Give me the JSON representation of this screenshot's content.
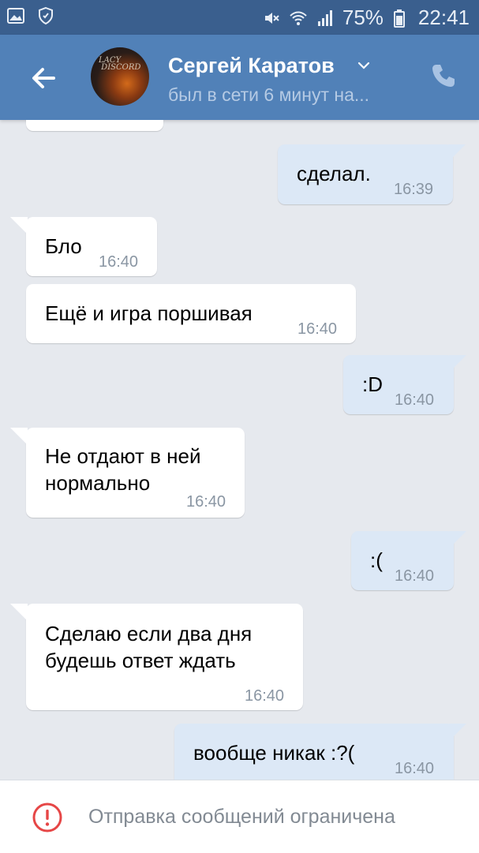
{
  "status_bar": {
    "battery": "75%",
    "time": "22:41"
  },
  "header": {
    "avatar_text": "LACY\nDISCORD",
    "name": "Сергей Каратов",
    "status": "был в сети 6 минут на..."
  },
  "messages": [
    {
      "dir": "out",
      "text": "сделал.",
      "time": "16:39"
    },
    {
      "dir": "in",
      "text": "Бло",
      "time": "16:40"
    },
    {
      "dir": "in",
      "text": "Ещё и игра поршивая",
      "time": "16:40"
    },
    {
      "dir": "out",
      "text": ":D",
      "time": "16:40"
    },
    {
      "dir": "in",
      "text_line1": "Не отдают в ней",
      "text_line2": "нормально",
      "time": "16:40"
    },
    {
      "dir": "out",
      "text": ":(",
      "time": "16:40"
    },
    {
      "dir": "in",
      "text_line1": "Сделаю если два дня",
      "text_line2": "будешь ответ ждать",
      "time": "16:40"
    },
    {
      "dir": "out",
      "text": "вообще никак :?(",
      "time": "16:40"
    }
  ],
  "bottom": {
    "notice": "Отправка сообщений ограничена"
  },
  "icons": {
    "status_left": [
      "gallery-icon",
      "shield-icon"
    ],
    "status_right": [
      "mute-icon",
      "wifi-icon",
      "signal-icon",
      "battery-icon"
    ],
    "header": [
      "back-arrow-icon",
      "chevron-down-icon",
      "phone-icon"
    ],
    "bottom": "warning-icon"
  },
  "colors": {
    "header": "#5181b8",
    "status_bar": "#3a5f8e",
    "chat_background": "#e6e9ee",
    "incoming_bubble": "#ffffff",
    "outgoing_bubble": "#dce8f6",
    "warning": "#e64646"
  }
}
